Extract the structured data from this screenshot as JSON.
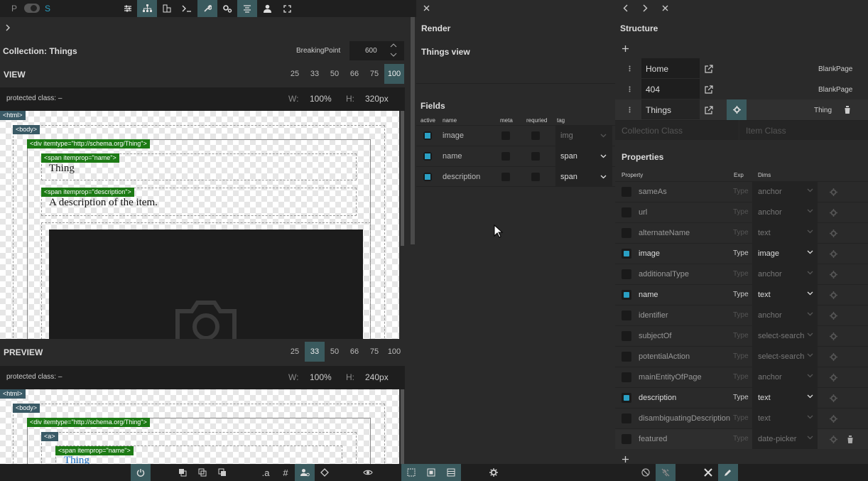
{
  "toolbar": {
    "p": "P",
    "s": "S"
  },
  "left": {
    "collection_title": "Collection: Things",
    "breakpoint_label": "BreakingPoint",
    "breakpoint_value": "600",
    "view": {
      "label": "VIEW",
      "bps": [
        "25",
        "33",
        "50",
        "66",
        "75",
        "100"
      ],
      "active": "100",
      "protected_label": "protected class: –",
      "w_label": "W:",
      "w_value": "100%",
      "h_label": "H:",
      "h_value": "320px",
      "tags": {
        "html": "<html>",
        "body": "<body>",
        "div": "<div itemtype=\"http://schema.org/Thing\">",
        "span_name": "<span itemprop=\"name\">",
        "span_desc": "<span itemprop=\"description\">"
      },
      "name_text": "Thing",
      "desc_text": "A description of the item."
    },
    "preview": {
      "label": "PREVIEW",
      "bps": [
        "25",
        "33",
        "50",
        "66",
        "75",
        "100"
      ],
      "active": "33",
      "protected_label": "protected class: –",
      "w_label": "W:",
      "w_value": "100%",
      "h_label": "H:",
      "h_value": "240px",
      "tags": {
        "html": "<html>",
        "body": "<body>",
        "div": "<div itemtype=\"http://schema.org/Thing\">",
        "a": "<a>",
        "span_name": "<span itemprop=\"name\">"
      },
      "name_text": "Thing"
    }
  },
  "middle": {
    "render_title": "Render",
    "view_title": "Things view",
    "fields_title": "Fields",
    "cols": {
      "active": "active",
      "name": "name",
      "meta": "meta",
      "required": "requried",
      "tag": "tag"
    },
    "fields": [
      {
        "name": "image",
        "tag": "img",
        "enabled": false
      },
      {
        "name": "name",
        "tag": "span",
        "enabled": true
      },
      {
        "name": "description",
        "tag": "span",
        "enabled": true
      }
    ]
  },
  "right": {
    "structure_title": "Structure",
    "pages": [
      {
        "name": "Home",
        "type": "BlankPage"
      },
      {
        "name": "404",
        "type": "BlankPage"
      },
      {
        "name": "Things",
        "type": "Thing"
      }
    ],
    "collection_class_ph": "Collection Class",
    "item_class_ph": "Item Class",
    "properties_title": "Properties",
    "cols": {
      "property": "Property",
      "exp": "Exp",
      "dims": "Dims"
    },
    "properties": [
      {
        "name": "sameAs",
        "type": "Type",
        "dim": "anchor",
        "active": false
      },
      {
        "name": "url",
        "type": "Type",
        "dim": "anchor",
        "active": false
      },
      {
        "name": "alternateName",
        "type": "Type",
        "dim": "text",
        "active": false
      },
      {
        "name": "image",
        "type": "Type",
        "dim": "image",
        "active": true
      },
      {
        "name": "additionalType",
        "type": "Type",
        "dim": "anchor",
        "active": false
      },
      {
        "name": "name",
        "type": "Type",
        "dim": "text",
        "active": true
      },
      {
        "name": "identifier",
        "type": "Type",
        "dim": "anchor",
        "active": false
      },
      {
        "name": "subjectOf",
        "type": "Type",
        "dim": "select-search",
        "active": false
      },
      {
        "name": "potentialAction",
        "type": "Type",
        "dim": "select-search",
        "active": false
      },
      {
        "name": "mainEntityOfPage",
        "type": "Type",
        "dim": "anchor",
        "active": false
      },
      {
        "name": "description",
        "type": "Type",
        "dim": "text",
        "active": true
      },
      {
        "name": "disambiguatingDescription",
        "type": "Type",
        "dim": "text",
        "active": false
      },
      {
        "name": "featured",
        "type": "Type",
        "dim": "date-picker",
        "active": false
      }
    ]
  },
  "bottom": {
    "dot_a": ".a",
    "hash": "#"
  },
  "colors": {
    "accent": "#2aa0c4",
    "active_btn": "#3a5a5e",
    "tag_green": "#1c7a14",
    "tag_blue": "#3a5a66"
  }
}
